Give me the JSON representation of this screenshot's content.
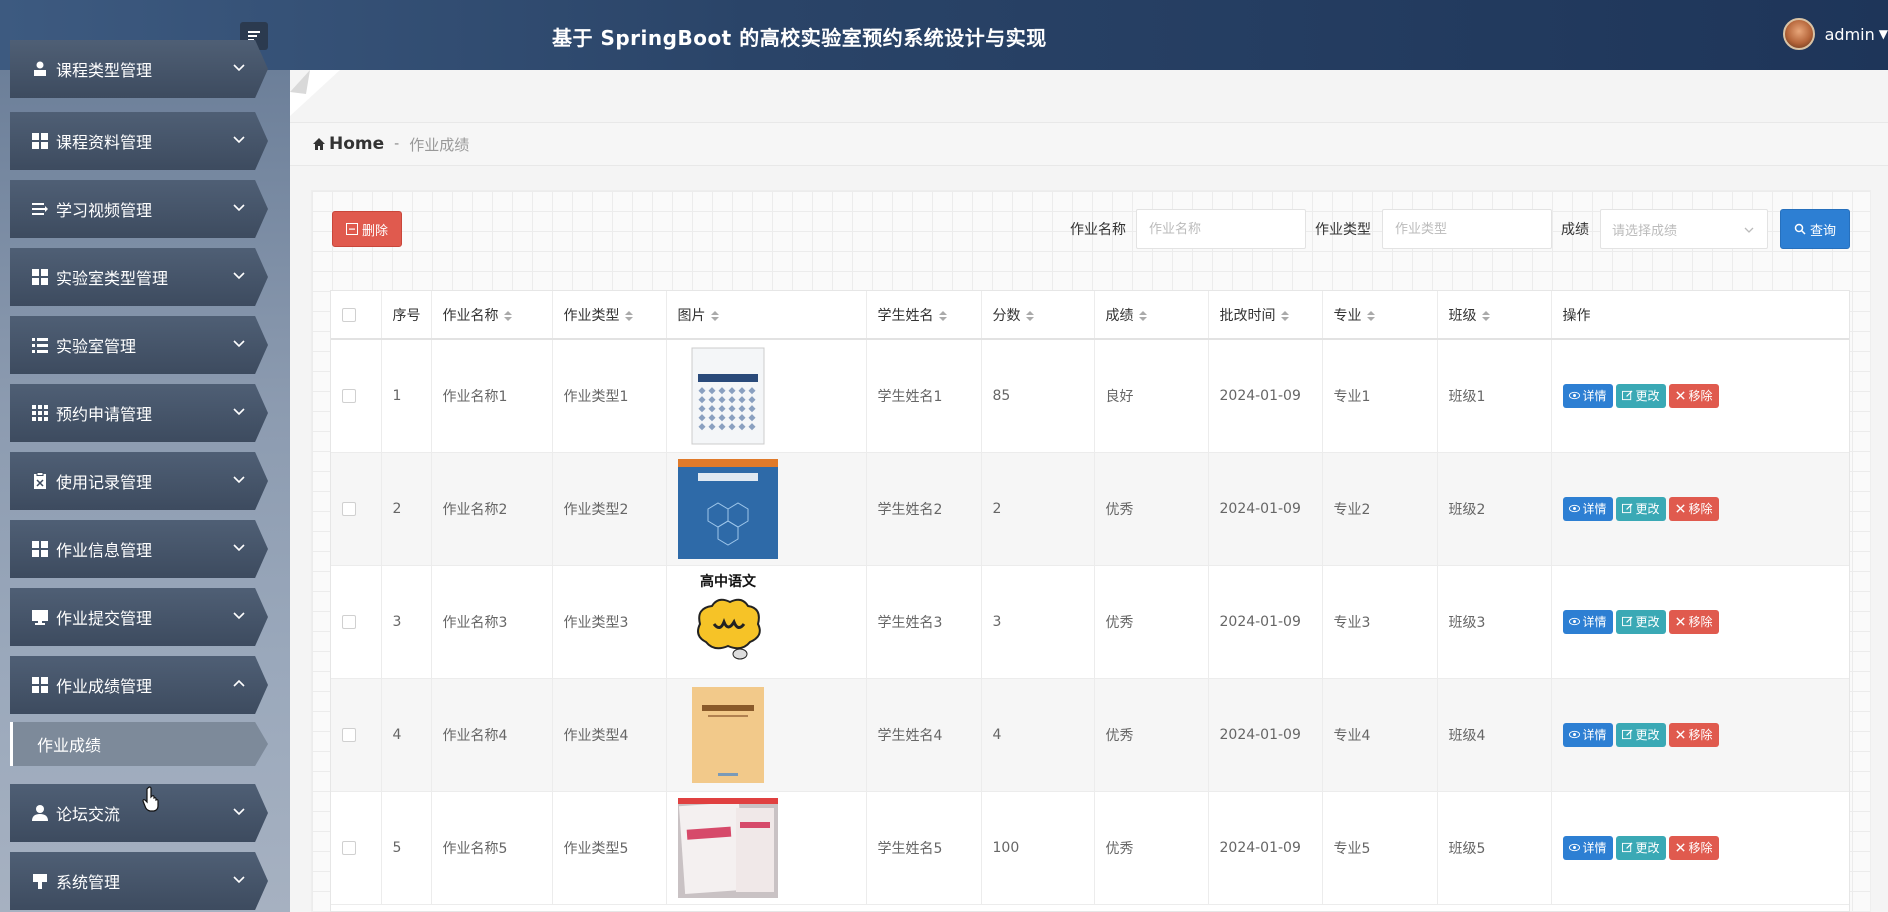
{
  "header": {
    "title": "基于 SpringBoot 的高校实验室预约系统设计与实现",
    "user": "admin"
  },
  "sidebar": {
    "items": [
      {
        "label": "课程类型管理",
        "icon": "user-icon"
      },
      {
        "label": "课程资料管理",
        "icon": "grid-icon"
      },
      {
        "label": "学习视频管理",
        "icon": "list-arrow-icon"
      },
      {
        "label": "实验室类型管理",
        "icon": "grid-icon"
      },
      {
        "label": "实验室管理",
        "icon": "list-icon"
      },
      {
        "label": "预约申请管理",
        "icon": "apps-icon"
      },
      {
        "label": "使用记录管理",
        "icon": "clipboard-icon"
      },
      {
        "label": "作业信息管理",
        "icon": "grid-icon"
      },
      {
        "label": "作业提交管理",
        "icon": "monitor-icon"
      },
      {
        "label": "作业成绩管理",
        "icon": "grid-icon",
        "expanded": true
      },
      {
        "label": "论坛交流",
        "icon": "person-icon"
      },
      {
        "label": "系统管理",
        "icon": "flag-icon"
      }
    ],
    "sub_item": "作业成绩"
  },
  "breadcrumb": {
    "home": "Home",
    "separator": "-",
    "current": "作业成绩"
  },
  "toolbar": {
    "delete_label": "删除",
    "search_label": "查询",
    "fields": [
      {
        "label": "作业名称",
        "placeholder": "作业名称"
      },
      {
        "label": "作业类型",
        "placeholder": "作业类型"
      },
      {
        "label": "成绩",
        "placeholder": "请选择成绩"
      }
    ]
  },
  "table": {
    "columns": [
      "序号",
      "作业名称",
      "作业类型",
      "图片",
      "学生姓名",
      "分数",
      "成绩",
      "批改时间",
      "专业",
      "班级",
      "操作"
    ],
    "rows": [
      {
        "no": "1",
        "name": "作业名称1",
        "type": "作业类型1",
        "image": "book-cover-math",
        "student": "学生姓名1",
        "score": "85",
        "grade": "良好",
        "time": "2024-01-09",
        "major": "专业1",
        "class": "班级1"
      },
      {
        "no": "2",
        "name": "作业名称2",
        "type": "作业类型2",
        "image": "book-cover-chemistry",
        "student": "学生姓名2",
        "score": "2",
        "grade": "优秀",
        "time": "2024-01-09",
        "major": "专业2",
        "class": "班级2"
      },
      {
        "no": "3",
        "name": "作业名称3",
        "type": "作业类型3",
        "image": "chinese-cartoon",
        "image_caption": "高中语文",
        "student": "学生姓名3",
        "score": "3",
        "grade": "优秀",
        "time": "2024-01-09",
        "major": "专业3",
        "class": "班级3"
      },
      {
        "no": "4",
        "name": "作业名称4",
        "type": "作业类型4",
        "image": "book-cover-standards",
        "student": "学生姓名4",
        "score": "4",
        "grade": "优秀",
        "time": "2024-01-09",
        "major": "专业4",
        "class": "班级4"
      },
      {
        "no": "5",
        "name": "作业名称5",
        "type": "作业类型5",
        "image": "book-photo",
        "student": "学生姓名5",
        "score": "100",
        "grade": "优秀",
        "time": "2024-01-09",
        "major": "专业5",
        "class": "班级5"
      }
    ],
    "actions": {
      "detail": "详情",
      "edit": "更改",
      "remove": "移除"
    }
  },
  "colors": {
    "topbar": "#2a4468",
    "delete": "#e05a4e",
    "primary": "#2d7fd3",
    "edit": "#3aa9b5"
  }
}
